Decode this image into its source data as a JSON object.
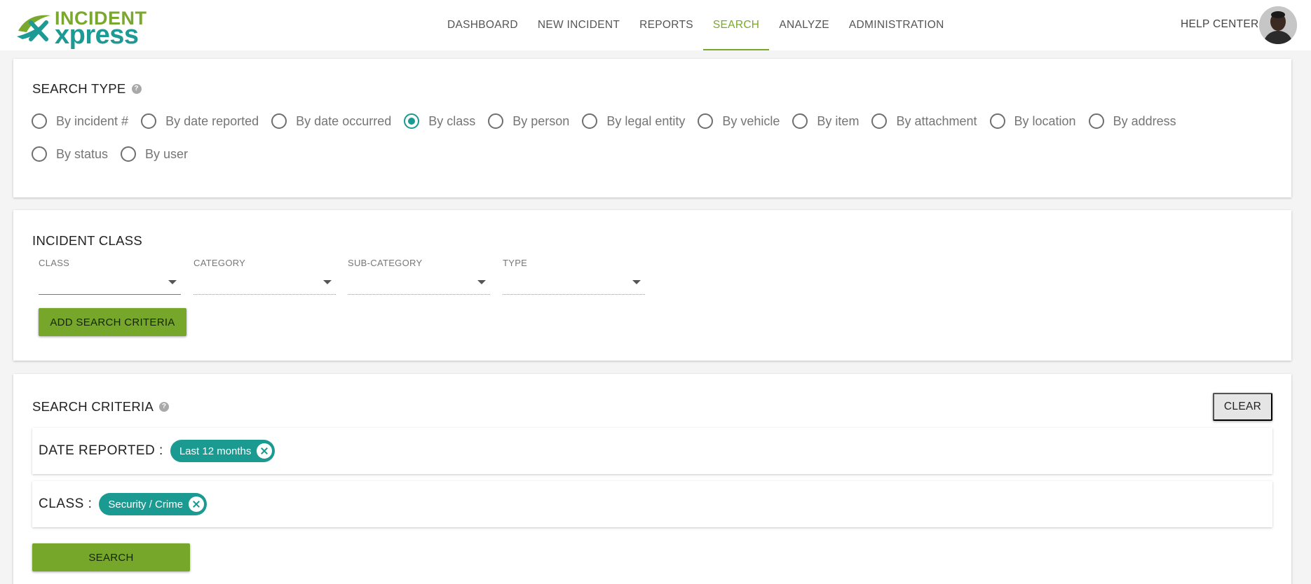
{
  "header": {
    "logo_top": "INCIDENT",
    "logo_bottom": "xpress",
    "nav": [
      {
        "label": "DASHBOARD"
      },
      {
        "label": "NEW INCIDENT"
      },
      {
        "label": "REPORTS"
      },
      {
        "label": "SEARCH",
        "active": true
      },
      {
        "label": "ANALYZE"
      },
      {
        "label": "ADMINISTRATION"
      }
    ],
    "help_label": "HELP CENTER"
  },
  "search_type": {
    "title": "SEARCH TYPE",
    "help_icon": "?",
    "options": [
      {
        "label": "By incident #",
        "checked": false
      },
      {
        "label": "By date reported",
        "checked": false
      },
      {
        "label": "By date occurred",
        "checked": false
      },
      {
        "label": "By class",
        "checked": true
      },
      {
        "label": "By person",
        "checked": false
      },
      {
        "label": "By legal entity",
        "checked": false
      },
      {
        "label": "By vehicle",
        "checked": false
      },
      {
        "label": "By item",
        "checked": false
      },
      {
        "label": "By attachment",
        "checked": false
      },
      {
        "label": "By location",
        "checked": false
      },
      {
        "label": "By address",
        "checked": false
      },
      {
        "label": "By status",
        "checked": false
      },
      {
        "label": "By user",
        "checked": false
      }
    ]
  },
  "incident_class": {
    "title": "INCIDENT CLASS",
    "fields": [
      {
        "label": "CLASS",
        "value": ""
      },
      {
        "label": "CATEGORY",
        "value": ""
      },
      {
        "label": "SUB-CATEGORY",
        "value": ""
      },
      {
        "label": "TYPE",
        "value": ""
      }
    ],
    "add_button": "ADD SEARCH CRITERIA"
  },
  "search_criteria": {
    "title": "SEARCH CRITERIA",
    "help_icon": "?",
    "clear_button": "CLEAR",
    "criteria": [
      {
        "label": "DATE REPORTED :",
        "chip": "Last 12 months"
      },
      {
        "label": "CLASS :",
        "chip": "Security / Crime"
      }
    ],
    "search_button": "SEARCH"
  },
  "colors": {
    "accent_green": "#7aa72d",
    "teal": "#1a9a91"
  }
}
